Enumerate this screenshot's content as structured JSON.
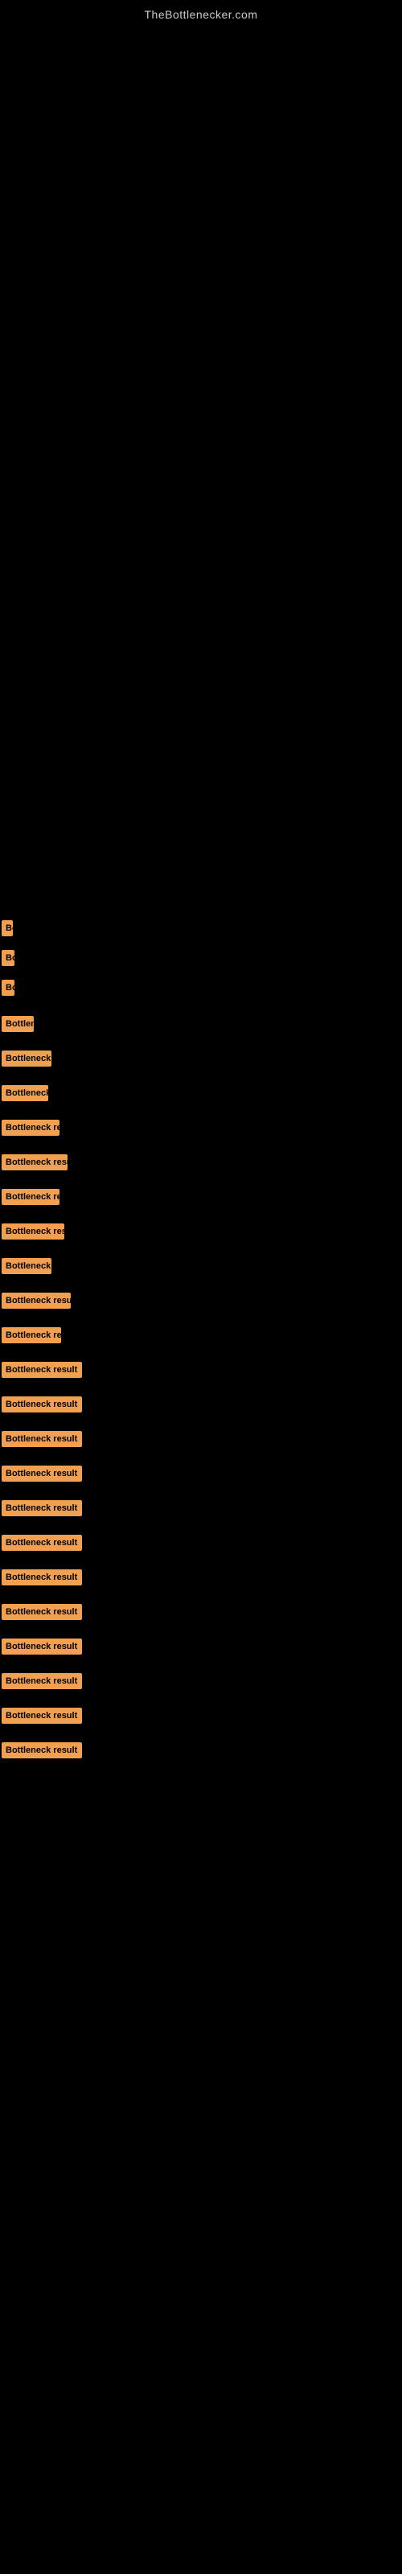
{
  "site": {
    "title": "TheBottlenecker.com"
  },
  "results": [
    {
      "id": 1,
      "label": "Bottleneck result",
      "width_class": "badge-w1",
      "text_visible": "B"
    },
    {
      "id": 2,
      "label": "Bottleneck result",
      "width_class": "badge-w2",
      "text_visible": "|"
    },
    {
      "id": 3,
      "label": "Bottleneck result",
      "width_class": "badge-w2",
      "text_visible": "B"
    },
    {
      "id": 4,
      "label": "Bottleneck result",
      "width_class": "badge-w4",
      "text_visible": "Bottle"
    },
    {
      "id": 5,
      "label": "Bottleneck result",
      "width_class": "badge-w5",
      "text_visible": "Bottleneck"
    },
    {
      "id": 6,
      "label": "Bottleneck result",
      "width_class": "badge-w6",
      "text_visible": "Bottlen"
    },
    {
      "id": 7,
      "label": "Bottleneck result",
      "width_class": "badge-w7",
      "text_visible": "Bottleneck r"
    },
    {
      "id": 8,
      "label": "Bottleneck result",
      "width_class": "badge-w8",
      "text_visible": "Bottleneck resu"
    },
    {
      "id": 9,
      "label": "Bottleneck result",
      "width_class": "badge-w7",
      "text_visible": "Bottleneck r"
    },
    {
      "id": 10,
      "label": "Bottleneck result",
      "width_class": "badge-w8",
      "text_visible": "Bottleneck re"
    },
    {
      "id": 11,
      "label": "Bottleneck result",
      "width_class": "badge-w6",
      "text_visible": "Bottleneck"
    },
    {
      "id": 12,
      "label": "Bottleneck result",
      "width_class": "badge-w9",
      "text_visible": "Bottleneck resu"
    },
    {
      "id": 13,
      "label": "Bottleneck result",
      "width_class": "badge-w8",
      "text_visible": "Bottleneck re"
    },
    {
      "id": 14,
      "label": "Bottleneck result",
      "width_class": "badge-w10",
      "text_visible": "Bottleneck result"
    },
    {
      "id": 15,
      "label": "Bottleneck result",
      "width_class": "badge-w10",
      "text_visible": "Bottleneck result"
    },
    {
      "id": 16,
      "label": "Bottleneck result",
      "width_class": "badge-w10",
      "text_visible": "Bottleneck result"
    },
    {
      "id": 17,
      "label": "Bottleneck result",
      "width_class": "badge-w10",
      "text_visible": "Bottleneck result"
    },
    {
      "id": 18,
      "label": "Bottleneck result",
      "width_class": "badge-w10",
      "text_visible": "Bottleneck result"
    },
    {
      "id": 19,
      "label": "Bottleneck result",
      "width_class": "badge-w10",
      "text_visible": "Bottleneck result"
    },
    {
      "id": 20,
      "label": "Bottleneck result",
      "width_class": "badge-w10",
      "text_visible": "Bottleneck result"
    },
    {
      "id": 21,
      "label": "Bottleneck result",
      "width_class": "badge-w10",
      "text_visible": "Bottleneck result"
    },
    {
      "id": 22,
      "label": "Bottleneck result",
      "width_class": "badge-w10",
      "text_visible": "Bottleneck result"
    },
    {
      "id": 23,
      "label": "Bottleneck result",
      "width_class": "badge-w10",
      "text_visible": "Bottleneck result"
    },
    {
      "id": 24,
      "label": "Bottleneck result",
      "width_class": "badge-w10",
      "text_visible": "Bottleneck result"
    },
    {
      "id": 25,
      "label": "Bottleneck result",
      "width_class": "badge-w10",
      "text_visible": "Bottleneck result"
    }
  ]
}
